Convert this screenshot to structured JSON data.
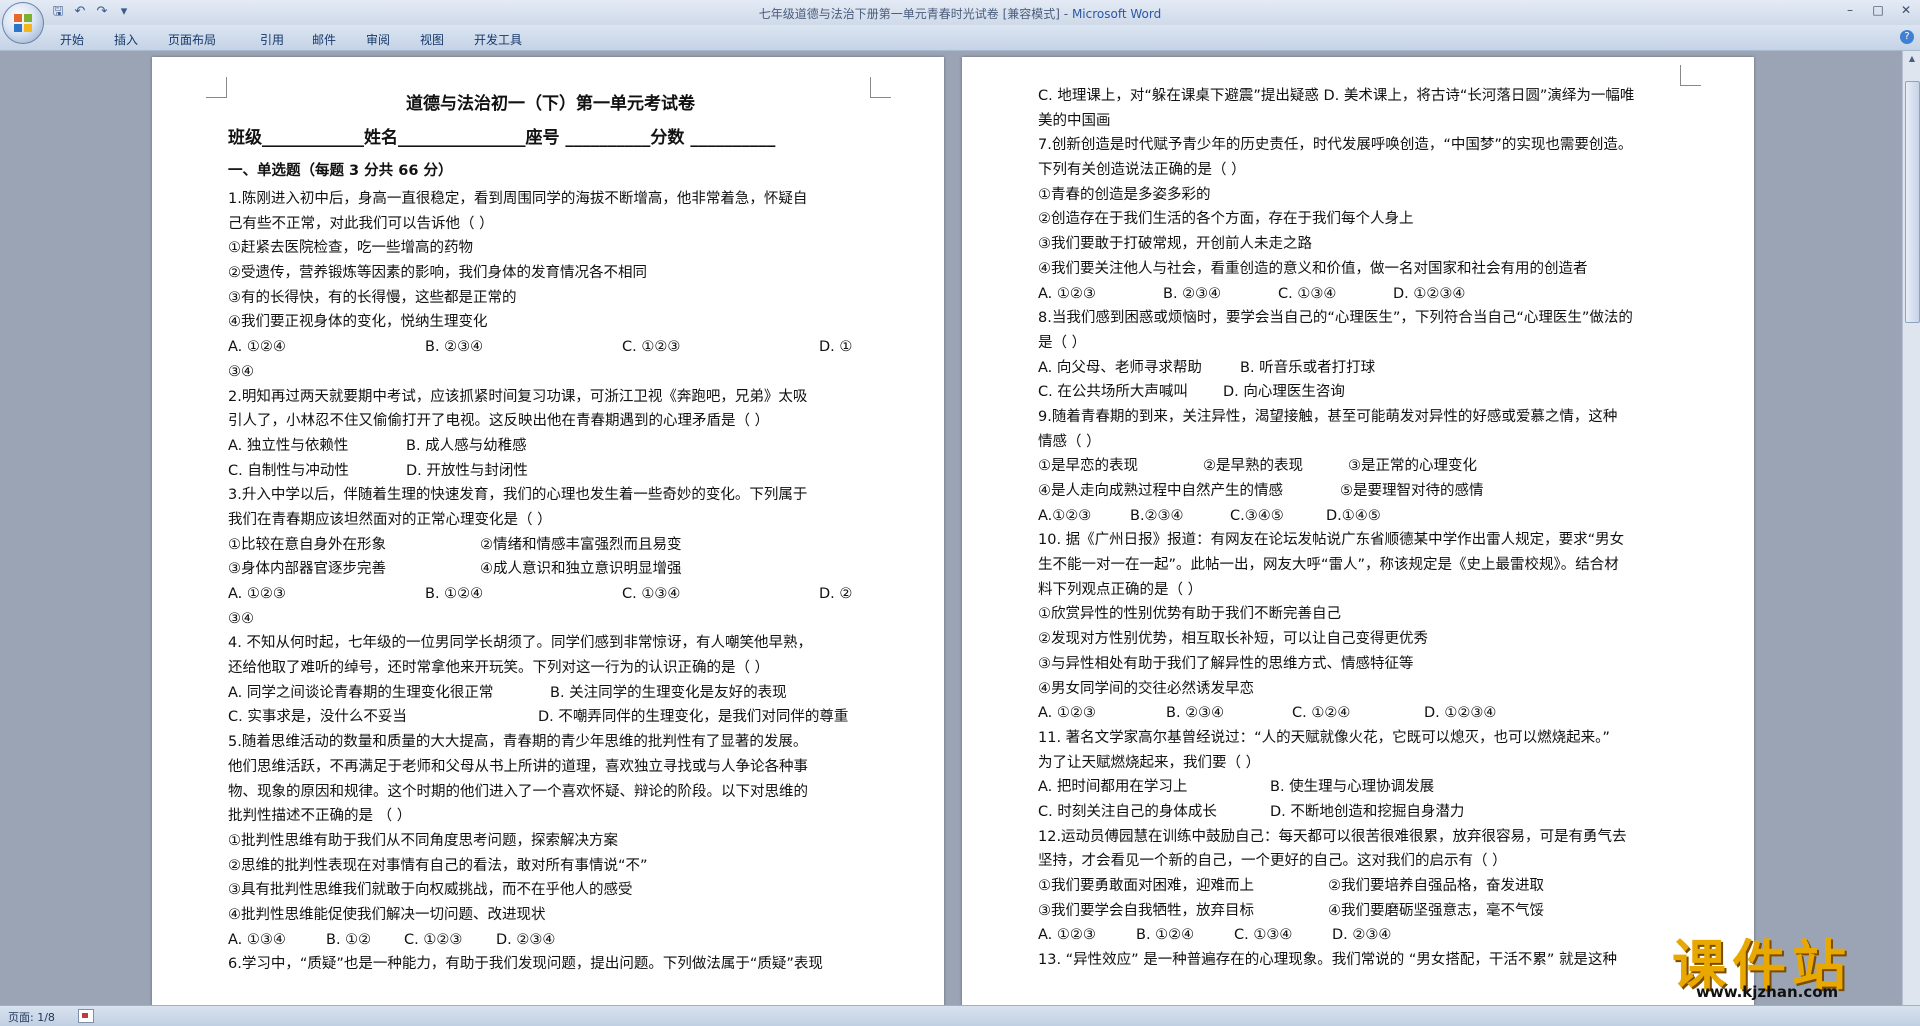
{
  "window": {
    "title_doc": "七年级道德与法治下册第一单元青春时光试卷 [兼容模式]",
    "title_sep": " - ",
    "title_app": "Microsoft Word"
  },
  "qat": [
    "save-icon",
    "undo-icon",
    "redo-icon",
    "customize-icon"
  ],
  "ribbon": {
    "tabs": [
      "开始",
      "插入",
      "页面布局",
      "引用",
      "邮件",
      "审阅",
      "视图",
      "开发工具"
    ]
  },
  "page1": {
    "title": "道德与法治初一（下）第一单元考试卷",
    "class_line": "班级____________姓名_______________座号 __________分数 __________",
    "section": "一、单选题（每题 3 分共 66 分）",
    "lines": [
      "1.陈刚进入初中后，身高一直很稳定，看到周围同学的海拔不断增高，他非常着急，怀疑自",
      "己有些不正常，对此我们可以告诉他（    ）",
      "①赶紧去医院检查，吃一些增高的药物",
      "②受遗传，营养锻炼等因素的影响，我们身体的发育情况各不相同",
      "③有的长得快，有的长得慢，这些都是正常的",
      "④我们要正视身体的变化，悦纳生理变化"
    ],
    "q1_opts": [
      "A. ①②④",
      "B. ②③④",
      "C. ①②③",
      "D. ①"
    ],
    "q1_cont": "③④",
    "lines2": [
      "2.明知再过两天就要期中考试，应该抓紧时间复习功课，可浙江卫视《奔跑吧，兄弟》太吸",
      "引人了，小林忍不住又偷偷打开了电视。这反映出他在青春期遇到的心理矛盾是（    ）"
    ],
    "q2_opts_a": [
      "A. 独立性与依赖性",
      "B. 成人感与幼稚感"
    ],
    "q2_opts_b": [
      " C. 自制性与冲动性",
      "D. 开放性与封闭性"
    ],
    "lines3": [
      "3.升入中学以后，伴随着生理的快速发育，我们的心理也发生着一些奇妙的变化。下列属于",
      "我们在青春期应该坦然面对的正常心理变化是（    ）"
    ],
    "q3_items_a": [
      "①比较在意自身外在形象",
      "②情绪和情感丰富强烈而且易变"
    ],
    "q3_items_b": [
      "③身体内部器官逐步完善",
      "④成人意识和独立意识明显增强"
    ],
    "q3_opts": [
      "A. ①②③",
      "B. ①②④",
      "C. ①③④",
      "D. ②"
    ],
    "q3_cont": "③④",
    "lines4": [
      "4. 不知从何时起，七年级的一位男同学长胡须了。同学们感到非常惊讶，有人嘲笑他早熟，",
      "还给他取了难听的绰号，还时常拿他来开玩笑。下列对这一行为的认识正确的是（    ）"
    ],
    "q4_opts_a": [
      "A. 同学之间谈论青春期的生理变化很正常",
      "B. 关注同学的生理变化是友好的表现"
    ],
    "q4_opts_b": [
      "C. 实事求是，没什么不妥当",
      "D. 不嘲弄同伴的生理变化，是我们对同伴的尊重"
    ],
    "lines5": [
      "5.随着思维活动的数量和质量的大大提高，青春期的青少年思维的批判性有了显著的发展。",
      "他们思维活跃，不再满足于老师和父母从书上所讲的道理，喜欢独立寻找或与人争论各种事",
      "物、现象的原因和规律。这个时期的他们进入了一个喜欢怀疑、辩论的阶段。以下对思维的",
      "批判性描述不正确的是 （  ）",
      "①批判性思维有助于我们从不同角度思考问题，探索解决方案",
      "②思维的批判性表现在对事情有自己的看法，敢对所有事情说“不”",
      "③具有批判性思维我们就敢于向权威挑战，而不在乎他人的感受",
      "④批判性思维能促使我们解决一切问题、改进现状"
    ],
    "q5_opts": [
      "A. ①③④",
      "B. ①②",
      "C. ①②③",
      "D. ②③④"
    ],
    "last": "6.学习中，“质疑”也是一种能力，有助于我们发现问题，提出问题。下列做法属于“质疑”表现"
  },
  "page2": {
    "lines": [
      "C. 地理课上，对“躲在课桌下避震”提出疑惑 D. 美术课上，将古诗“长河落日圆”演绎为一幅唯",
      "美的中国画",
      "7.创新创造是时代赋予青少年的历史责任，时代发展呼唤创造，“中国梦”的实现也需要创造。",
      "下列有关创造说法正确的是（    ）",
      "①青春的创造是多姿多彩的",
      "②创造存在于我们生活的各个方面，存在于我们每个人身上",
      "③我们要敢于打破常规，开创前人未走之路",
      "④我们要关注他人与社会，看重创造的意义和价值，做一名对国家和社会有用的创造者"
    ],
    "q7_opts": [
      "A. ①②③",
      "B. ②③④",
      "C. ①③④",
      "D. ①②③④"
    ],
    "lines8": [
      "8.当我们感到困惑或烦恼时，要学会当自己的“心理医生”，下列符合当自己“心理医生”做法的",
      "是（    ）"
    ],
    "q8_opts_a": [
      "A. 向父母、老师寻求帮助",
      "B. 听音乐或者打打球"
    ],
    "q8_opts_b": [
      "C. 在公共场所大声喊叫",
      "D. 向心理医生咨询"
    ],
    "lines9": [
      "9.随着青春期的到来，关注异性，渴望接触，甚至可能萌发对异性的好感或爱慕之情，这种",
      "情感（    ）"
    ],
    "q9_items_a": [
      "①是早恋的表现",
      "②是早熟的表现",
      "③是正常的心理变化"
    ],
    "q9_items_b": [
      "④是人走向成熟过程中自然产生的情感",
      "⑤是要理智对待的感情"
    ],
    "q9_opts": [
      "A.①②③",
      "B.②③④",
      "C.③④⑤",
      "D.①④⑤"
    ],
    "lines10": [
      "10. 据《广州日报》报道：有网友在论坛发帖说广东省顺德某中学作出雷人规定，要求“男女",
      "生不能一对一在一起”。此帖一出，网友大呼“雷人”，称该规定是《史上最雷校规》。结合材",
      "料下列观点正确的是（    ）",
      "①欣赏异性的性别优势有助于我们不断完善自己",
      "②发现对方性别优势，相互取长补短，可以让自己变得更优秀",
      "③与异性相处有助于我们了解异性的思维方式、情感特征等",
      "④男女同学间的交往必然诱发早恋"
    ],
    "q10_opts": [
      "A. ①②③",
      "B. ②③④",
      "C. ①②④",
      "D. ①②③④"
    ],
    "lines11": [
      "11.  著名文学家高尔基曾经说过：“人的天赋就像火花，它既可以熄灭，也可以燃烧起来。”",
      "为了让天赋燃烧起来，我们要（    ）"
    ],
    "q11_opts_a": [
      "A. 把时间都用在学习上",
      "B. 使生理与心理协调发展"
    ],
    "q11_opts_b": [
      "C. 时刻关注自己的身体成长",
      "D. 不断地创造和挖掘自身潜力"
    ],
    "lines12": [
      "12.运动员傅园慧在训练中鼓励自己：每天都可以很苦很难很累，放弃很容易，可是有勇气去",
      "坚持，才会看见一个新的自己，一个更好的自己。这对我们的启示有（    ）"
    ],
    "q12_items_a": [
      "①我们要勇敢面对困难，迎难而上",
      "②我们要培养自强品格，奋发进取"
    ],
    "q12_items_b": [
      "③我们要学会自我牺牲，放弃目标",
      "④我们要磨砺坚强意志，毫不气馁"
    ],
    "q12_opts": [
      "A. ①②③",
      "B. ①②④",
      "C. ①③④",
      "D. ②③④"
    ],
    "last": "13. “异性效应” 是一种普遍存在的心理现象。我们常说的 “男女搭配，干活不累” 就是这种"
  },
  "status": {
    "page_info": "页面: 1/8"
  },
  "watermark": {
    "title": "课件站",
    "url": "www.kjzhan.com"
  }
}
